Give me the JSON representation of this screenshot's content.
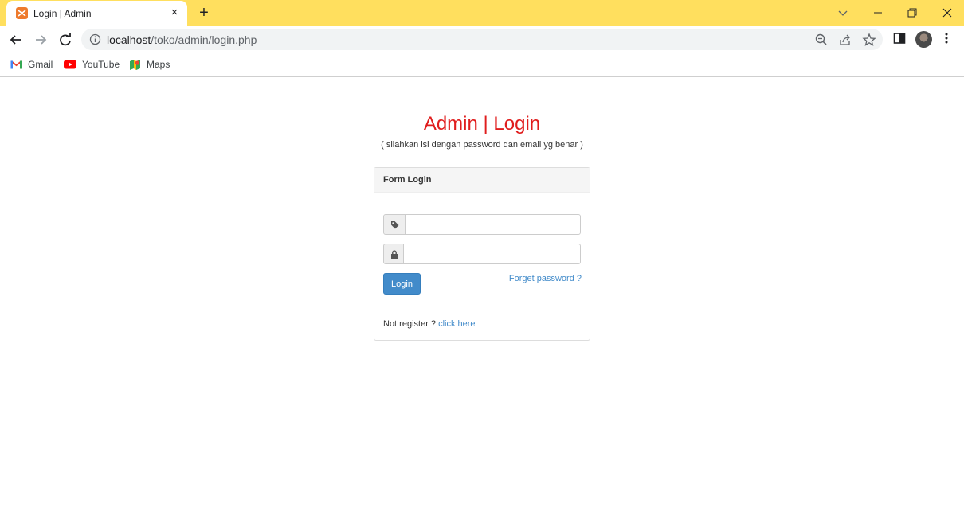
{
  "browser": {
    "tab_title": "Login | Admin",
    "tab_close": "×",
    "new_tab": "+",
    "url_host": "localhost",
    "url_path": "/toko/admin/login.php",
    "tabstrip_color": "#ffdf5e",
    "bookmarks": [
      {
        "label": "Gmail",
        "icon": "gmail-icon"
      },
      {
        "label": "YouTube",
        "icon": "youtube-icon"
      },
      {
        "label": "Maps",
        "icon": "maps-icon"
      }
    ]
  },
  "page": {
    "title": "Admin | Login",
    "subtitle": "( silahkan isi dengan password dan email yg benar )",
    "title_color": "#e01d1d",
    "form": {
      "heading": "Form Login",
      "email_icon": "tag-icon",
      "password_icon": "lock-icon",
      "email_value": "",
      "password_value": "",
      "login_label": "Login",
      "forget_label": "Forget password ?",
      "register_prompt": "Not register ?",
      "register_link": "click here"
    }
  }
}
